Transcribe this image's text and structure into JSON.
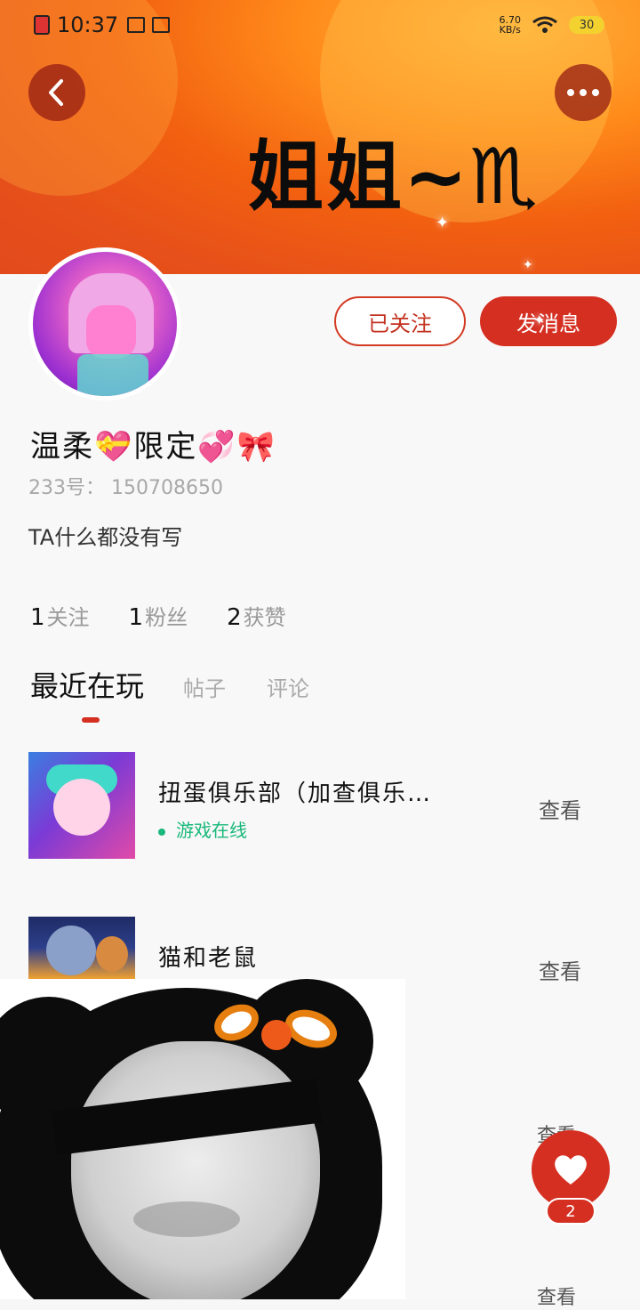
{
  "status_bar": {
    "time": "10:37",
    "net_speed": "6.70",
    "net_unit": "KB/s",
    "battery": "30"
  },
  "header": {
    "banner_text": "姐姐~♏",
    "back_icon": "chevron-left-icon",
    "more_icon": "more-dots-icon"
  },
  "profile": {
    "username": "温柔💝限定💞🎀",
    "id_label": "233号：",
    "id_value": "150708650",
    "bio": "TA什么都没有写",
    "follow_label": "已关注",
    "message_label": "发消息"
  },
  "stats": [
    {
      "num": "1",
      "label": "关注"
    },
    {
      "num": "1",
      "label": "粉丝"
    },
    {
      "num": "2",
      "label": "获赞"
    }
  ],
  "tabs": {
    "active": "最近在玩",
    "posts": "帖子",
    "comments": "评论"
  },
  "games": [
    {
      "name": "扭蛋俱乐部（加查俱乐…",
      "status": "游戏在线",
      "view": "查看"
    },
    {
      "name": "猫和老鼠",
      "status": "",
      "view": "查看"
    }
  ],
  "partial_views": [
    "查看",
    "查看"
  ],
  "like": {
    "icon": "heart-icon",
    "count": "2"
  },
  "colors": {
    "accent": "#d52f21",
    "online": "#19b87a",
    "banner": "#f26010"
  }
}
